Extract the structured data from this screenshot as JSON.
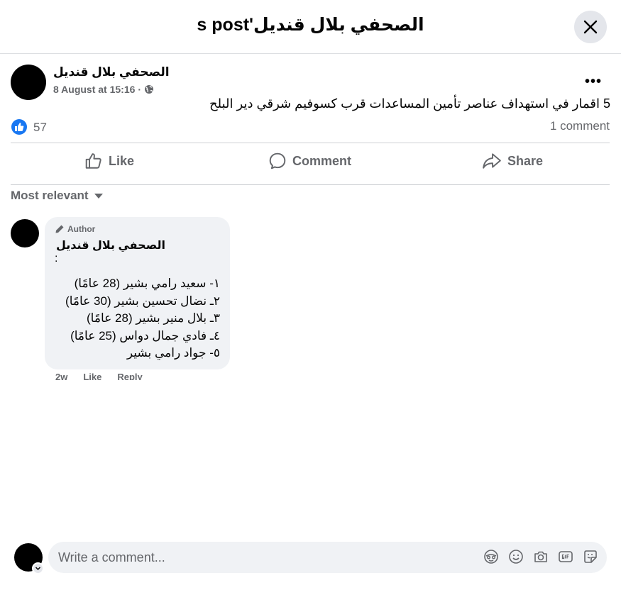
{
  "header": {
    "title": "الصحفي بلال قنديل's post"
  },
  "post": {
    "author": "الصحفي بلال قنديل",
    "date": "8 August at 15:16",
    "separator": "·",
    "text": "5 اقمار في استهداف عناصر تأمين المساعدات قرب كسوفيم شرقي دير البلح",
    "more": "•••",
    "reaction_count": "57",
    "comment_count": "1 comment"
  },
  "actions": {
    "like": "Like",
    "comment": "Comment",
    "share": "Share"
  },
  "sort": {
    "label": "Most relevant"
  },
  "comment": {
    "badge": "Author",
    "author": "الصحفي بلال قنديل",
    "colon": ":",
    "lines": [
      "١- سعيد رامي بشير (28 عامًا)",
      "٢ـ نضال تحسين بشير (30 عامًا)",
      "٣ـ بلال منير بشير (28 عامًا)",
      "٤ـ فادي جمال دواس (25 عامًا)",
      "٥- جواد رامي بشير"
    ],
    "time": "2w",
    "like": "Like",
    "reply": "Reply"
  },
  "composer": {
    "placeholder": "Write a comment..."
  },
  "colors": {
    "accent": "#1877f2",
    "secondary_text": "#65676b",
    "bubble_bg": "#f0f2f5"
  }
}
